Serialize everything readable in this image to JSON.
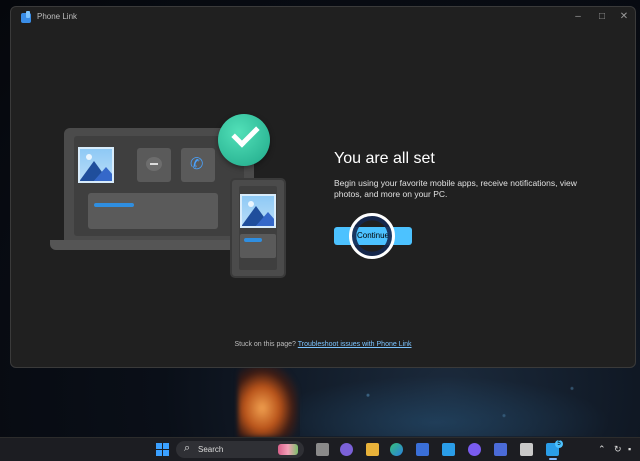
{
  "window": {
    "app_title": "Phone Link",
    "controls": {
      "minimize": "–",
      "maximize": "□",
      "close": "✕"
    }
  },
  "main": {
    "heading": "You are all set",
    "description": "Begin using your favorite mobile apps, receive notifications, view photos, and more on your PC.",
    "continue_label": "Continue",
    "help_prefix": "Stuck on this page?",
    "help_link": "Troubleshoot issues with Phone Link"
  },
  "illustration": {
    "icons": [
      "laptop-icon",
      "phone-icon",
      "photo-icon",
      "chat-icon",
      "call-icon",
      "checkmark-icon"
    ]
  },
  "taskbar": {
    "search_label": "Search",
    "phone_link_badge": "5",
    "accent": "#4cc2ff"
  },
  "colors": {
    "accent": "#4cc2ff",
    "window_bg": "#202020",
    "success": "#2ec49c"
  }
}
